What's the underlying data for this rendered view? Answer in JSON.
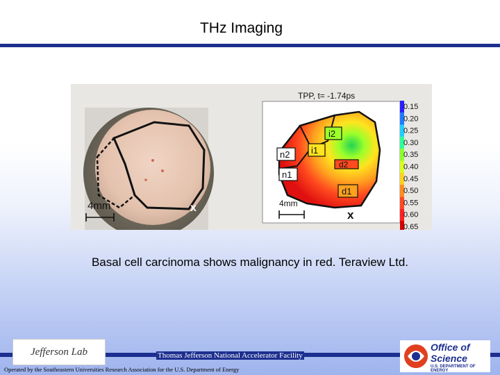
{
  "slide": {
    "title": "THz Imaging",
    "caption": "Basal cell carcinoma shows malignancy in red.  Teraview Ltd."
  },
  "figure": {
    "thz_title": "TPP, t= -1.74ps",
    "scale_left": "4mm",
    "scale_right": "4mm",
    "x_marker": "x",
    "region_labels": [
      "n2",
      "i1",
      "i2",
      "d2",
      "n1",
      "d1"
    ],
    "colorbar_ticks": [
      "0.15",
      "0.20",
      "0.25",
      "0.30",
      "0.35",
      "0.40",
      "0.45",
      "0.50",
      "0.55",
      "0.60",
      "0.65"
    ],
    "colorbar_colors": [
      "#2a1fff",
      "#1f7bff",
      "#1fcfff",
      "#2cff9a",
      "#8cff2c",
      "#d9ff1f",
      "#ffd21f",
      "#ff8c1f",
      "#ff4a1f",
      "#ff1f1f",
      "#d40000"
    ]
  },
  "footer": {
    "logo_text": "Jefferson Lab",
    "facility": "Thomas Jefferson National Accelerator Facility",
    "operated_by": "Operated by the Southeastern Universities Research Association for the U.S. Department of Energy",
    "doe_line1": "Office of",
    "doe_line2": "Science",
    "doe_line3": "U.S. DEPARTMENT OF ENERGY"
  }
}
